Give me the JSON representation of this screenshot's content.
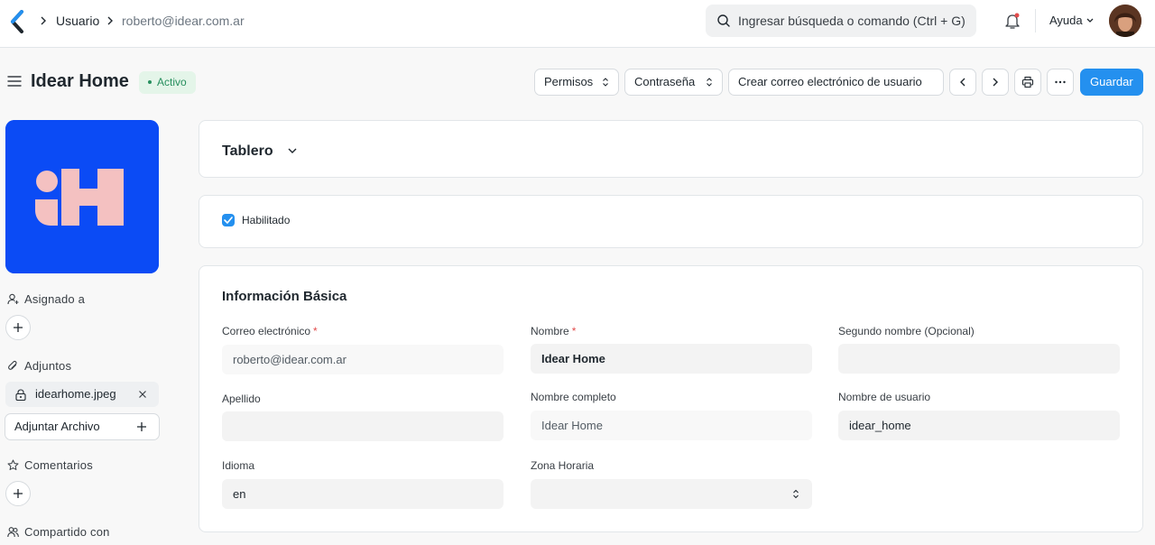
{
  "navbar": {
    "breadcrumbs": [
      "Usuario",
      "roberto@idear.com.ar"
    ],
    "search_placeholder": "Ingresar búsqueda o comando (Ctrl + G)",
    "help_label": "Ayuda"
  },
  "page": {
    "title": "Idear Home",
    "status": "Activo"
  },
  "toolbar": {
    "permissions_label": "Permisos",
    "password_label": "Contraseña",
    "create_email_label": "Crear correo electrónico de usuario",
    "save_label": "Guardar"
  },
  "sidebar": {
    "assigned_label": "Asignado a",
    "attachments_label": "Adjuntos",
    "attachment_file": "idearhome.jpeg",
    "attach_button_label": "Adjuntar Archivo",
    "comments_label": "Comentarios",
    "shared_label": "Compartido con"
  },
  "sections": {
    "dashboard_title": "Tablero",
    "enabled_label": "Habilitado",
    "enabled_checked": true,
    "basic_info_title": "Información Básica"
  },
  "form": {
    "email": {
      "label": "Correo electrónico",
      "value": "roberto@idear.com.ar"
    },
    "first_name": {
      "label": "Nombre",
      "value": "Idear Home"
    },
    "middle_name": {
      "label": "Segundo nombre (Opcional)",
      "value": ""
    },
    "last_name": {
      "label": "Apellido",
      "value": ""
    },
    "full_name": {
      "label": "Nombre completo",
      "value": "Idear Home"
    },
    "username": {
      "label": "Nombre de usuario",
      "value": "idear_home"
    },
    "language": {
      "label": "Idioma",
      "value": "en"
    },
    "timezone": {
      "label": "Zona Horaria",
      "value": ""
    }
  },
  "colors": {
    "primary": "#2490ef",
    "status_green": "#278f5e",
    "logo_blue": "#0b4bf5",
    "logo_pink": "#f4c1c1"
  }
}
